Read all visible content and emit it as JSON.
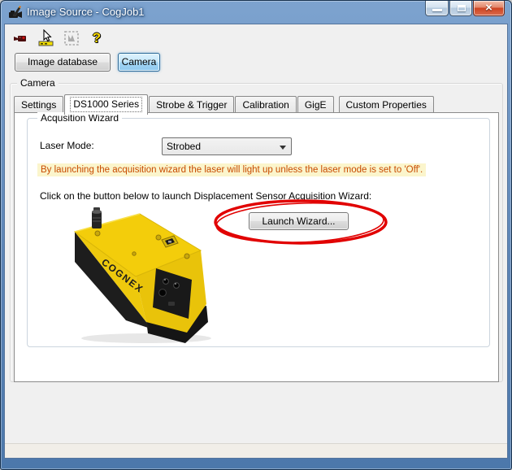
{
  "window": {
    "title": "Image Source - CogJob1",
    "controls": {
      "minimize": "minimize",
      "maximize": "maximize",
      "close_glyph": "×"
    }
  },
  "toolbar": {
    "icons": [
      {
        "name": "acquire-camera-icon",
        "disabled": false
      },
      {
        "name": "live-display-icon",
        "disabled": false
      },
      {
        "name": "image-region-icon",
        "disabled": true
      },
      {
        "name": "help-icon",
        "glyph": "?",
        "disabled": false
      }
    ]
  },
  "source_buttons": [
    {
      "label": "Image database",
      "active": false
    },
    {
      "label": "Camera",
      "active": true
    }
  ],
  "camera_group": {
    "label": "Camera"
  },
  "tabs": [
    {
      "label": "Settings",
      "active": false
    },
    {
      "label": "DS1000 Series",
      "active": true
    },
    {
      "label": "Strobe & Trigger",
      "active": false
    },
    {
      "label": "Calibration",
      "active": false
    },
    {
      "label": "GigE",
      "active": false
    },
    {
      "label": "Custom Properties",
      "active": false
    }
  ],
  "wizard": {
    "group_label": "Acqusition Wizard",
    "laser_mode_label": "Laser Mode:",
    "laser_mode_value": "Strobed",
    "warning": "By launching the acquisition wizard the laser will light up unless the laser mode is set to 'Off'.",
    "instruction": "Click on the button below to launch Displacement Sensor Acquisition Wizard:",
    "launch_button": "Launch Wizard...",
    "device_brand": "COGNEX"
  },
  "annotation": {
    "shape": "red-ellipse-highlight",
    "color": "#e10000"
  },
  "colors": {
    "titlebar_top": "#7da3cf",
    "warning_bg": "#fbf5cc",
    "warning_text": "#c84b00",
    "camera_button_fill": "#a3d6f4",
    "device_yellow": "#f3cd0b"
  }
}
